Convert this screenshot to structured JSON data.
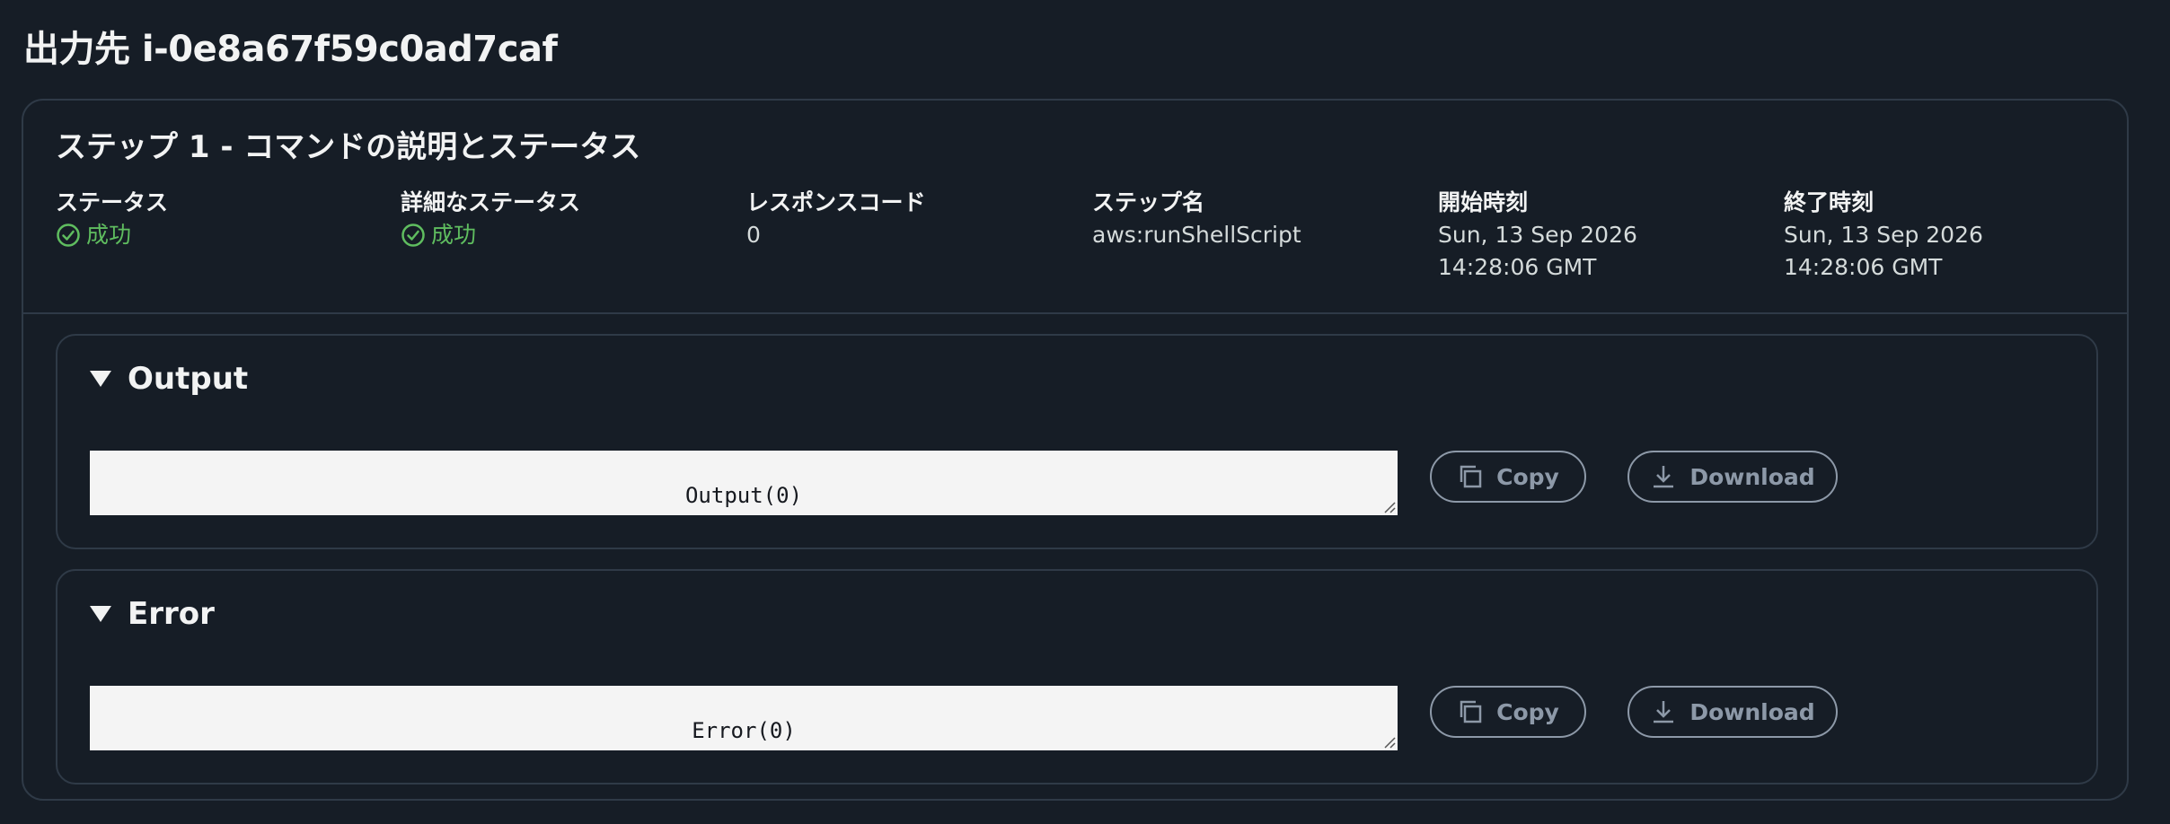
{
  "page": {
    "title": "出力先 i-0e8a67f59c0ad7caf"
  },
  "step": {
    "title": "ステップ 1 - コマンドの説明とステータス",
    "fields": {
      "status_label": "ステータス",
      "status_value": "成功",
      "detailed_status_label": "詳細なステータス",
      "detailed_status_value": "成功",
      "response_code_label": "レスポンスコード",
      "response_code_value": "0",
      "step_name_label": "ステップ名",
      "step_name_value": "aws:runShellScript",
      "start_time_label": "開始時刻",
      "start_time_value": "Sun, 13 Sep 2026 14:28:06 GMT",
      "end_time_label": "終了時刻",
      "end_time_value": "Sun, 13 Sep 2026 14:28:06 GMT"
    }
  },
  "output": {
    "title": "Output",
    "content": "Output(0)",
    "copy_label": "Copy",
    "download_label": "Download"
  },
  "error": {
    "title": "Error",
    "content": "Error(0)",
    "copy_label": "Copy",
    "download_label": "Download"
  },
  "colors": {
    "background": "#161d26",
    "border": "#2f3a47",
    "success": "#5fbd5f",
    "button": "#8d99a8",
    "output_bg": "#f4f4f4"
  },
  "icons": {
    "status": "check-circle-icon",
    "expand": "caret-down-icon",
    "copy": "copy-icon",
    "download": "download-icon",
    "resize": "resize-handle-icon"
  }
}
